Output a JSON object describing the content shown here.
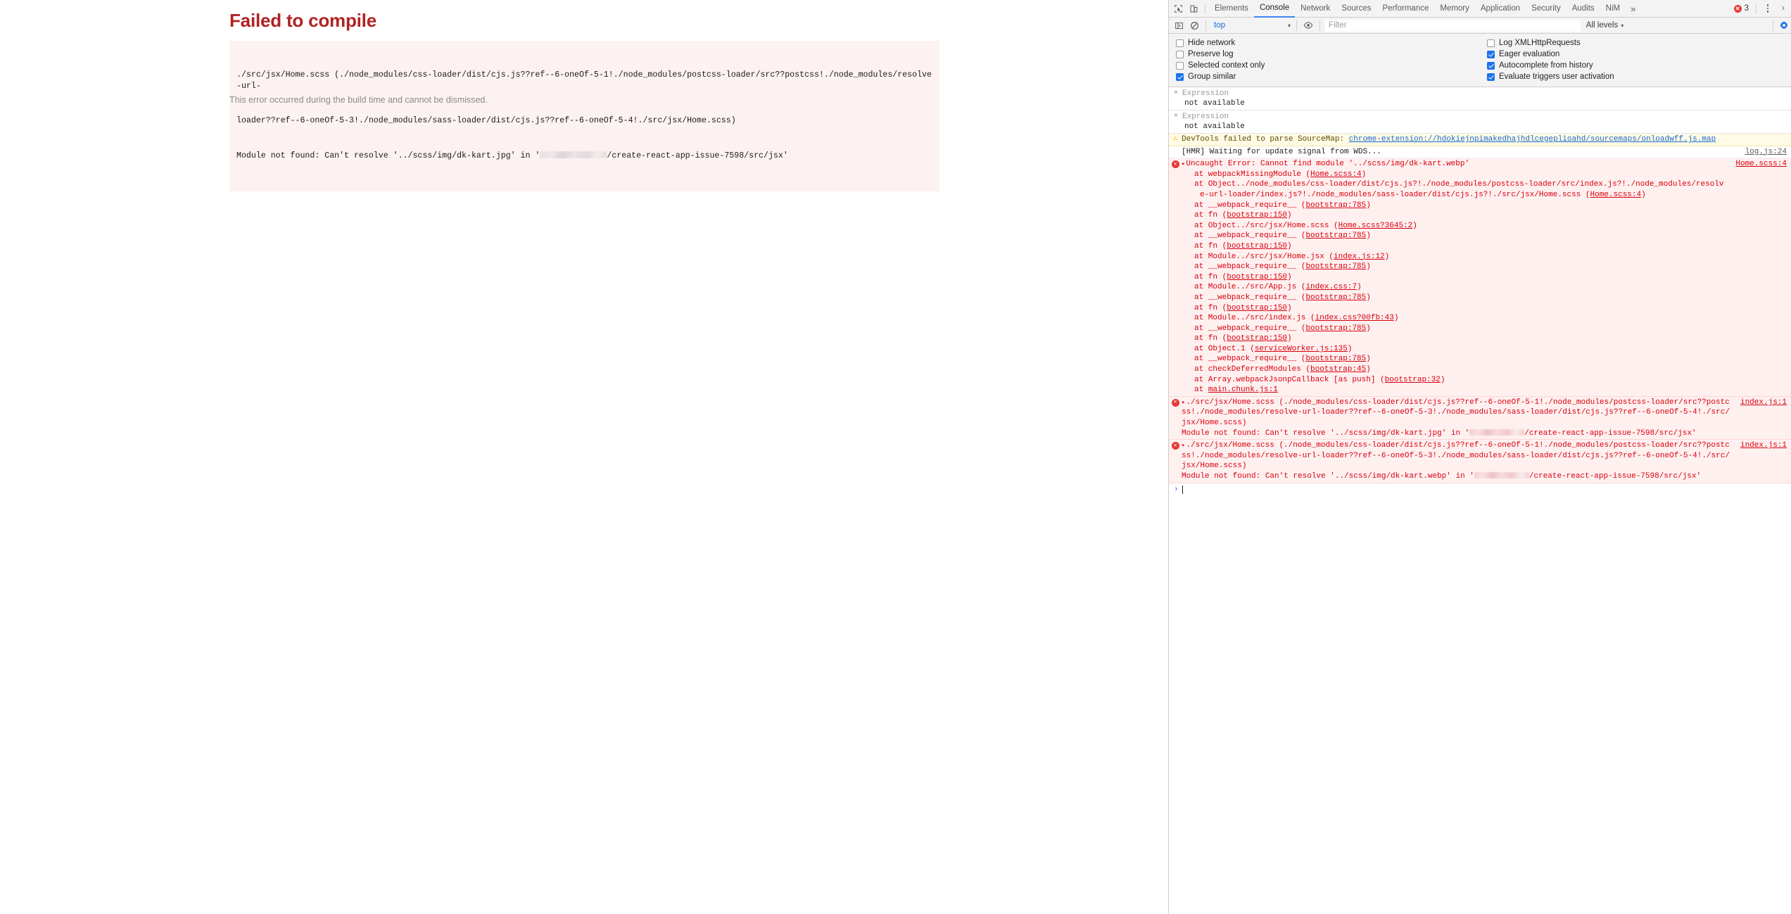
{
  "page": {
    "title": "Failed to compile",
    "error_line1": "./src/jsx/Home.scss (./node_modules/css-loader/dist/cjs.js??ref--6-oneOf-5-1!./node_modules/postcss-loader/src??postcss!./node_modules/resolve-url-",
    "error_line2": "loader??ref--6-oneOf-5-3!./node_modules/sass-loader/dist/cjs.js??ref--6-oneOf-5-4!./src/jsx/Home.scss)",
    "error_line3_prefix": "Module not found: Can't resolve '../scss/img/dk-kart.jpg' in '",
    "error_line3_suffix": "/create-react-app-issue-7598/src/jsx'",
    "note": "This error occurred during the build time and cannot be dismissed."
  },
  "devtools": {
    "tabs": [
      {
        "label": "Elements",
        "selected": false
      },
      {
        "label": "Console",
        "selected": true
      },
      {
        "label": "Network",
        "selected": false
      },
      {
        "label": "Sources",
        "selected": false
      },
      {
        "label": "Performance",
        "selected": false
      },
      {
        "label": "Memory",
        "selected": false
      },
      {
        "label": "Application",
        "selected": false
      },
      {
        "label": "Security",
        "selected": false
      },
      {
        "label": "Audits",
        "selected": false
      },
      {
        "label": "NiM",
        "selected": false
      }
    ],
    "overflow_label": "»",
    "error_badge": {
      "glyph": "✕",
      "count": "3"
    },
    "close_label": "›",
    "toolbar": {
      "context_value": "top",
      "caret": "▾",
      "filter_placeholder": "Filter",
      "filter_value": "",
      "levels_label": "All levels"
    },
    "settings": {
      "left": [
        {
          "label": "Hide network",
          "checked": false
        },
        {
          "label": "Preserve log",
          "checked": false
        },
        {
          "label": "Selected context only",
          "checked": false
        },
        {
          "label": "Group similar",
          "checked": true
        }
      ],
      "right": [
        {
          "label": "Log XMLHttpRequests",
          "checked": false
        },
        {
          "label": "Eager evaluation",
          "checked": true
        },
        {
          "label": "Autocomplete from history",
          "checked": true
        },
        {
          "label": "Evaluate triggers user activation",
          "checked": true
        }
      ]
    },
    "expressions": [
      {
        "name": "Expression",
        "value": "not available",
        "close_glyph": "×"
      },
      {
        "name": "Expression",
        "value": "not available",
        "close_glyph": "×"
      }
    ],
    "messages": {
      "sourcemap": {
        "icon": "⚠",
        "text": "DevTools failed to parse SourceMap: ",
        "link": "chrome-extension://hdokiejnpimakedhajhdlcegeplioahd/sourcemaps/onloadwff.js.map"
      },
      "hmr": {
        "text": "[HMR] Waiting for update signal from WDS...",
        "source": "log.js:24"
      },
      "uncaught": {
        "icon": "✕",
        "disclosure": "▸",
        "title": "Uncaught Error: Cannot find module '../scss/img/dk-kart.webp'",
        "source": "Home.scss:4",
        "stack": [
          {
            "text": "at webpackMissingModule (",
            "link": "Home.scss:4",
            "tail": ")"
          },
          {
            "text": "at Object../node_modules/css-loader/dist/cjs.js?!./node_modules/postcss-loader/src/index.js?!./node_modules/resolve-url-loader/index.js?!./node_modules/sass-loader/dist/cjs.js?!./src/jsx/Home.scss (",
            "link": "Home.scss:4",
            "tail": ")"
          },
          {
            "text": "at __webpack_require__ (",
            "link": "bootstrap:785",
            "tail": ")"
          },
          {
            "text": "at fn (",
            "link": "bootstrap:150",
            "tail": ")"
          },
          {
            "text": "at Object../src/jsx/Home.scss (",
            "link": "Home.scss?3645:2",
            "tail": ")"
          },
          {
            "text": "at __webpack_require__ (",
            "link": "bootstrap:785",
            "tail": ")"
          },
          {
            "text": "at fn (",
            "link": "bootstrap:150",
            "tail": ")"
          },
          {
            "text": "at Module../src/jsx/Home.jsx (",
            "link": "index.js:12",
            "tail": ")"
          },
          {
            "text": "at __webpack_require__ (",
            "link": "bootstrap:785",
            "tail": ")"
          },
          {
            "text": "at fn (",
            "link": "bootstrap:150",
            "tail": ")"
          },
          {
            "text": "at Module../src/App.js (",
            "link": "index.css:7",
            "tail": ")"
          },
          {
            "text": "at __webpack_require__ (",
            "link": "bootstrap:785",
            "tail": ")"
          },
          {
            "text": "at fn (",
            "link": "bootstrap:150",
            "tail": ")"
          },
          {
            "text": "at Module../src/index.js (",
            "link": "index.css?00fb:43",
            "tail": ")"
          },
          {
            "text": "at __webpack_require__ (",
            "link": "bootstrap:785",
            "tail": ")"
          },
          {
            "text": "at fn (",
            "link": "bootstrap:150",
            "tail": ")"
          },
          {
            "text": "at Object.1 (",
            "link": "serviceWorker.js:135",
            "tail": ")"
          },
          {
            "text": "at __webpack_require__ (",
            "link": "bootstrap:785",
            "tail": ")"
          },
          {
            "text": "at checkDeferredModules (",
            "link": "bootstrap:45",
            "tail": ")"
          },
          {
            "text": "at Array.webpackJsonpCallback [as push] (",
            "link": "bootstrap:32",
            "tail": ")"
          },
          {
            "text": "at ",
            "link": "main.chunk.js:1",
            "tail": ""
          }
        ]
      },
      "module_errors": [
        {
          "icon": "✕",
          "disclosure": "▸",
          "line1": "./src/jsx/Home.scss (./node_modules/css-loader/dist/cjs.js??ref--6-oneOf-5-1!./node_modules/postcss-loader/src??",
          "line2": "postcss!./node_modules/resolve-url-loader??ref--6-oneOf-5-3!./node_modules/sass-loader/dist/cjs.js??ref--6-oneOf-5-",
          "line3": "4!./src/jsx/Home.scss)",
          "line4_prefix": "Module not found: Can't resolve '../scss/img/dk-kart.jpg' in '",
          "line4_suffix": "/create-react-app-issue-7598/src/jsx'",
          "source": "index.js:1"
        },
        {
          "icon": "✕",
          "disclosure": "▸",
          "line1": "./src/jsx/Home.scss (./node_modules/css-loader/dist/cjs.js??ref--6-oneOf-5-1!./node_modules/postcss-loader/src??",
          "line2": "postcss!./node_modules/resolve-url-loader??ref--6-oneOf-5-3!./node_modules/sass-loader/dist/cjs.js??ref--6-oneOf-5-",
          "line3": "4!./src/jsx/Home.scss)",
          "line4_prefix": "Module not found: Can't resolve '../scss/img/dk-kart.webp' in '",
          "line4_suffix": "/create-react-app-issue-7598/src/jsx'",
          "source": "index.js:1"
        }
      ],
      "prompt_caret": "›"
    }
  }
}
